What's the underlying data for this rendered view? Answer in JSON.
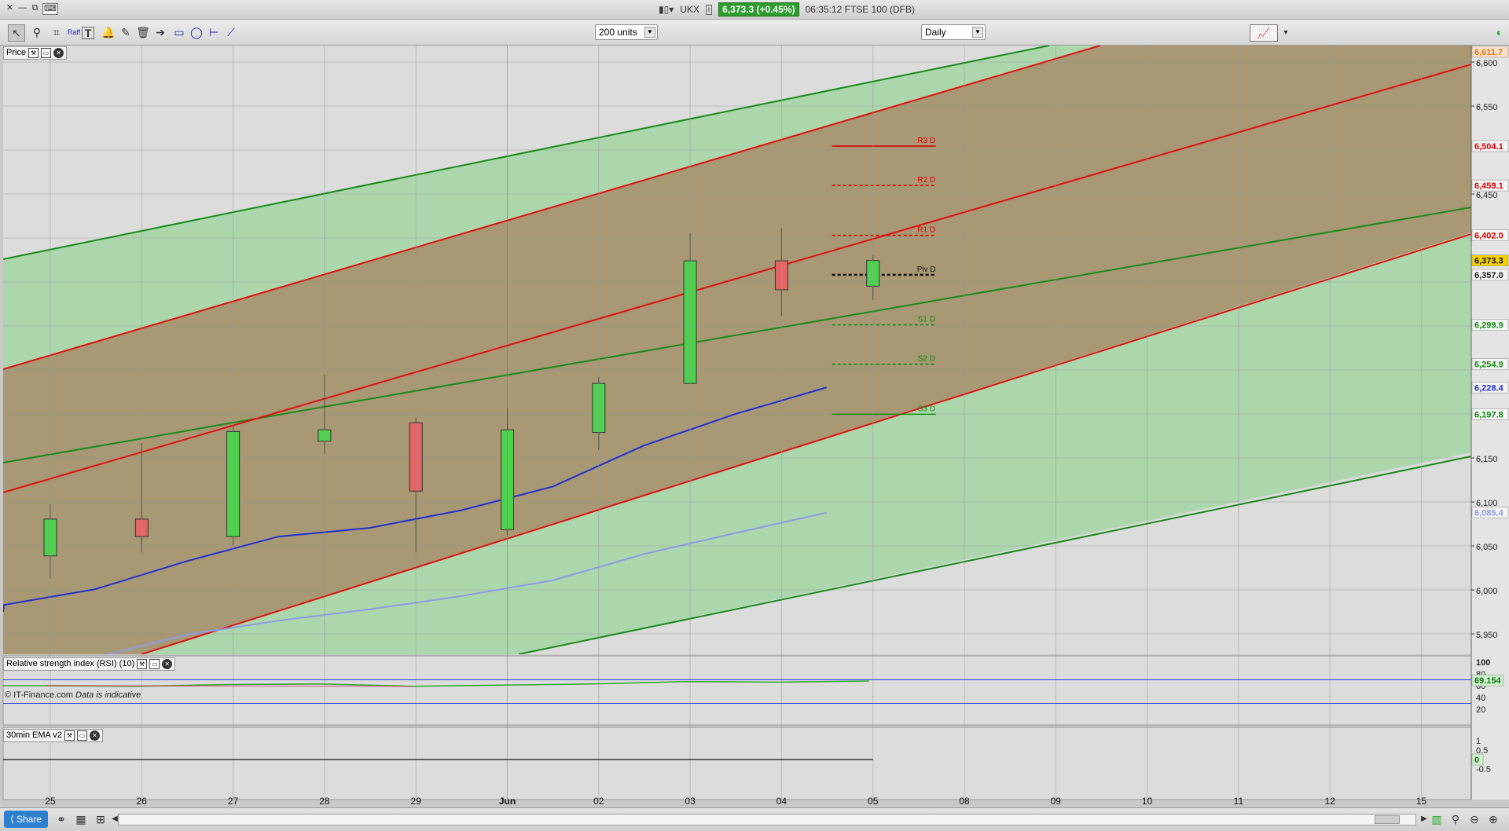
{
  "window": {
    "symbol": "UKX",
    "price_badge": "6,373.3 (+0.45%)",
    "time_title": "06:35:12 FTSE 100 (DFB)"
  },
  "toolbar": {
    "units_select": "200 units",
    "interval_select": "Daily",
    "raff_label": "Raff"
  },
  "panels": {
    "price_label": "Price",
    "rsi_label": "Relative strength index (RSI) (10)",
    "ema_label": "30min EMA v2",
    "credit": "© IT-Finance.com",
    "credit_note": "Data is indicative"
  },
  "bottom": {
    "share_label": "Share"
  },
  "colors": {
    "bull": "#4ed24e",
    "bear": "#e36565",
    "channel_green": "#1a8a1a",
    "channel_red": "#e01010",
    "ma_fast": "#2030d0",
    "ma_slow": "#8d9be6"
  },
  "chart_data": {
    "type": "candlestick",
    "x_labels": [
      "25",
      "26",
      "27",
      "28",
      "29",
      "Jun",
      "02",
      "03",
      "04",
      "05",
      "08",
      "09",
      "10",
      "11",
      "12",
      "15"
    ],
    "y_ticks": [
      "6,600",
      "6,550",
      "6,450",
      "6,150",
      "6,100",
      "6,050",
      "6,000",
      "5,950"
    ],
    "candles": [
      {
        "x": "25",
        "open": 6036,
        "high": 6095,
        "low": 6010,
        "close": 6078
      },
      {
        "x": "26",
        "open": 6078,
        "high": 6165,
        "low": 6040,
        "close": 6058
      },
      {
        "x": "27",
        "open": 6058,
        "high": 6185,
        "low": 6048,
        "close": 6178
      },
      {
        "x": "28",
        "open": 6167,
        "high": 6243,
        "low": 6152,
        "close": 6180
      },
      {
        "x": "29",
        "open": 6188,
        "high": 6194,
        "low": 6040,
        "close": 6110
      },
      {
        "x": "Jun",
        "open": 6066,
        "high": 6205,
        "low": 6060,
        "close": 6180
      },
      {
        "x": "02",
        "open": 6177,
        "high": 6240,
        "low": 6157,
        "close": 6233
      },
      {
        "x": "03",
        "open": 6233,
        "high": 6405,
        "low": 6233,
        "close": 6373
      },
      {
        "x": "04",
        "open": 6373,
        "high": 6410,
        "low": 6310,
        "close": 6340
      },
      {
        "x": "05",
        "open": 6344,
        "high": 6380,
        "low": 6328,
        "close": 6373.3
      }
    ],
    "pivot_levels": [
      {
        "label": "R3 D",
        "value": 6504.1,
        "value_label": "6,504.1"
      },
      {
        "label": "R2 D",
        "value": 6459.1,
        "value_label": "6,459.1"
      },
      {
        "label": "R1 D",
        "value": 6402.0,
        "value_label": "6,402.0"
      },
      {
        "label": "Piv D",
        "value": 6357.0,
        "value_label": "6,357.0"
      },
      {
        "label": "S1 D",
        "value": 6299.9,
        "value_label": "6,299.9"
      },
      {
        "label": "S2 D",
        "value": 6254.9,
        "value_label": "6,254.9"
      },
      {
        "label": "S3 D",
        "value": 6197.8,
        "value_label": "6,197.8"
      }
    ],
    "other_value_labels": {
      "top": "6,611.7",
      "last": "6,373.3",
      "ma_fast": "6,228.4",
      "ma_slow": "6,085.4"
    },
    "ma_fast": [
      5980,
      5998,
      6030,
      6058,
      6068,
      6088,
      6115,
      6162,
      6198,
      6228.4
    ],
    "ma_slow": [
      5890,
      5920,
      5946,
      5962,
      5975,
      5990,
      6008,
      6038,
      6062,
      6085.4
    ],
    "rsi": {
      "ticks": [
        "100",
        "80",
        "60",
        "40",
        "20"
      ],
      "last_label": "69.154",
      "values": [
        60,
        59,
        62,
        63,
        59,
        61,
        63,
        67,
        66,
        68
      ]
    },
    "ema": {
      "ticks": [
        "1",
        "0.5",
        "0",
        "-0.5"
      ],
      "last_label": "0"
    }
  }
}
